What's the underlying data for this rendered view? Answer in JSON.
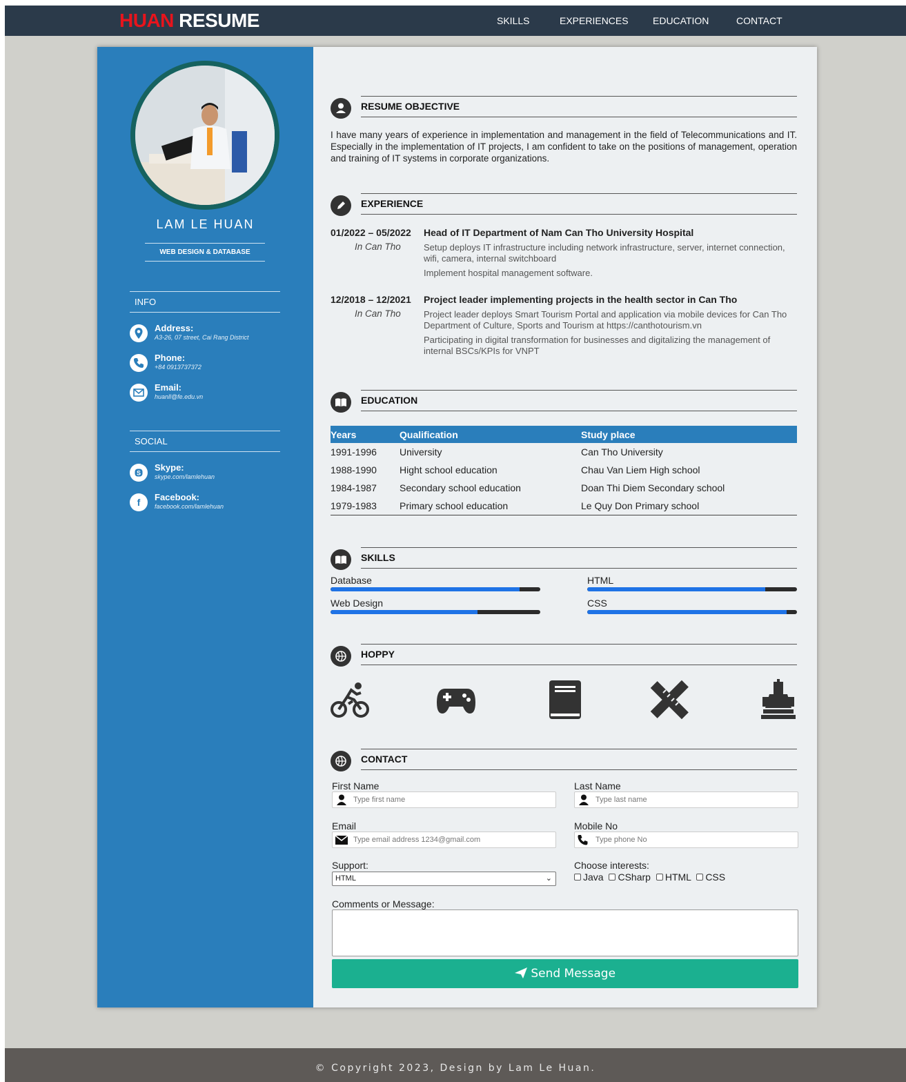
{
  "brand": {
    "first": "HUAN",
    "second": "RESUME"
  },
  "nav": [
    {
      "label": "SKILLS"
    },
    {
      "label": "EXPERIENCES"
    },
    {
      "label": "EDUCATION"
    },
    {
      "label": "CONTACT"
    }
  ],
  "profile": {
    "name": "LAM LE HUAN",
    "title": "WEB DESIGN & DATABASE"
  },
  "info": {
    "heading": "INFO",
    "items": [
      {
        "icon": "map-marker-icon",
        "label": "Address:",
        "value": "A3-26, 07 street, Cai Rang District"
      },
      {
        "icon": "phone-icon",
        "label": "Phone:",
        "value": "+84 0913737372"
      },
      {
        "icon": "envelope-icon",
        "label": "Email:",
        "value": "huanll@fe.edu.vn"
      }
    ]
  },
  "social": {
    "heading": "SOCIAL",
    "items": [
      {
        "icon": "skype-icon",
        "label": "Skype:",
        "value": "skype.com/lamlehuan"
      },
      {
        "icon": "facebook-icon",
        "label": "Facebook:",
        "value": "facebook.com/lamlehuan"
      }
    ]
  },
  "objective": {
    "heading": "RESUME OBJECTIVE",
    "text": "I have many years of experience in implementation and management in the field of Telecommunications and IT. Especially in the implementation of IT projects, I am confident to take on the positions of management, operation and training of IT systems in corporate organizations."
  },
  "experience": {
    "heading": "EXPERIENCE",
    "items": [
      {
        "dates": "01/2022 – 05/2022",
        "place": "In Can Tho",
        "role": "Head of IT Department of Nam Can Tho University Hospital",
        "details": [
          "Setup deploys IT infrastructure including network infrastructure, server, internet connection, wifi, camera, internal switchboard",
          "Implement hospital management software."
        ]
      },
      {
        "dates": "12/2018 – 12/2021",
        "place": "In Can Tho",
        "role": "Project leader implementing projects in the health sector in Can Tho",
        "details": [
          "Project leader deploys Smart Tourism Portal and application via mobile devices for Can Tho Department of Culture, Sports and Tourism at https://canthotourism.vn",
          "Participating in digital transformation for businesses and digitalizing the management of internal BSCs/KPIs for VNPT"
        ]
      }
    ]
  },
  "education": {
    "heading": "EDUCATION",
    "columns": [
      "Years",
      "Qualification",
      "Study place"
    ],
    "rows": [
      [
        "1991-1996",
        "University",
        "Can Tho University"
      ],
      [
        "1988-1990",
        "Hight school education",
        "Chau Van Liem High school"
      ],
      [
        "1984-1987",
        "Secondary school education",
        "Doan Thi Diem Secondary school"
      ],
      [
        "1979-1983",
        "Primary school education",
        "Le Quy Don Primary school"
      ]
    ]
  },
  "skills": {
    "heading": "SKILLS",
    "items": [
      {
        "name": "Database",
        "level": 0.9
      },
      {
        "name": "HTML",
        "level": 0.85
      },
      {
        "name": "Web Design",
        "level": 0.7
      },
      {
        "name": "CSS",
        "level": 0.95
      }
    ]
  },
  "hobby": {
    "heading": "HOPPY",
    "icons": [
      "bicycle-icon",
      "gamepad-icon",
      "book-icon",
      "drafting-tools-icon",
      "chess-icon"
    ]
  },
  "contact": {
    "heading": "CONTACT",
    "first_name": {
      "label": "First Name",
      "placeholder": "Type first name",
      "value": ""
    },
    "last_name": {
      "label": "Last Name",
      "placeholder": "Type last name",
      "value": ""
    },
    "email": {
      "label": "Email",
      "placeholder": "Type email address 1234@gmail.com",
      "value": ""
    },
    "mobile": {
      "label": "Mobile No",
      "placeholder": "Type phone No",
      "value": ""
    },
    "support": {
      "label": "Support:",
      "selected": "HTML"
    },
    "interests": {
      "label": "Choose interests:",
      "options": [
        "Java",
        "CSharp",
        "HTML",
        "CSS"
      ]
    },
    "comments": {
      "label": "Comments or Message:"
    },
    "send_label": "Send Message"
  },
  "footer": {
    "text": "© Copyright 2023, Design by Lam Le Huan."
  },
  "colors": {
    "navbar": "#2b3a4a",
    "sidebar": "#2a7ebb",
    "accent_red": "#e8141c",
    "send_button": "#1bb090",
    "skill_fill": "#1f73e6"
  }
}
